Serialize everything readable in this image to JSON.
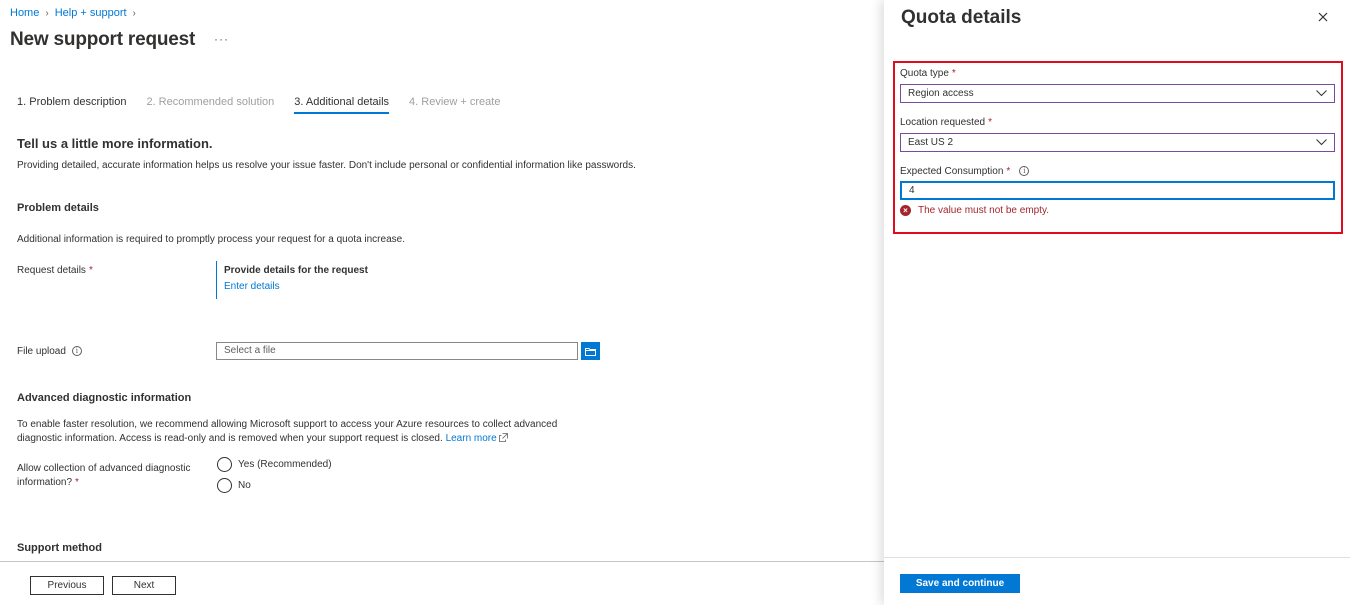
{
  "breadcrumb": {
    "home": "Home",
    "help": "Help + support"
  },
  "page": {
    "title": "New support request",
    "more": "···"
  },
  "tabs": [
    {
      "label": "1. Problem description",
      "state": "done"
    },
    {
      "label": "2. Recommended solution",
      "state": "disabled"
    },
    {
      "label": "3. Additional details",
      "state": "active"
    },
    {
      "label": "4. Review + create",
      "state": "disabled"
    }
  ],
  "intro": {
    "heading": "Tell us a little more information.",
    "text": "Providing detailed, accurate information helps us resolve your issue faster. Don't include personal or confidential information like passwords."
  },
  "problem_details": {
    "heading": "Problem details",
    "text": "Additional information is required to promptly process your request for a quota increase.",
    "request_label": "Request details",
    "required_mark": "*",
    "request_title": "Provide details for the request",
    "request_link": "Enter details",
    "file_label": "File upload",
    "file_placeholder": "Select a file"
  },
  "diagnostics": {
    "heading": "Advanced diagnostic information",
    "text1": "To enable faster resolution, we recommend allowing Microsoft support to access your Azure resources to collect advanced",
    "text2": "diagnostic information. Access is read-only and is removed when your support request is closed.",
    "learn_more": "Learn more",
    "allow_label_1": "Allow collection of advanced diagnostic",
    "allow_label_2": "information?",
    "option_yes": "Yes (Recommended)",
    "option_no": "No"
  },
  "support_method": {
    "heading": "Support method"
  },
  "footer": {
    "previous": "Previous",
    "next": "Next"
  },
  "panel": {
    "title": "Quota details",
    "quota_type_label": "Quota type",
    "quota_type_value": "Region access",
    "location_label": "Location requested",
    "location_value": "East US 2",
    "consumption_label": "Expected Consumption",
    "consumption_value": "4",
    "error": "The value must not be empty.",
    "save": "Save and continue"
  },
  "colors": {
    "accent": "#0078d4",
    "error": "#a4262c",
    "highlight": "#e00b1c"
  }
}
